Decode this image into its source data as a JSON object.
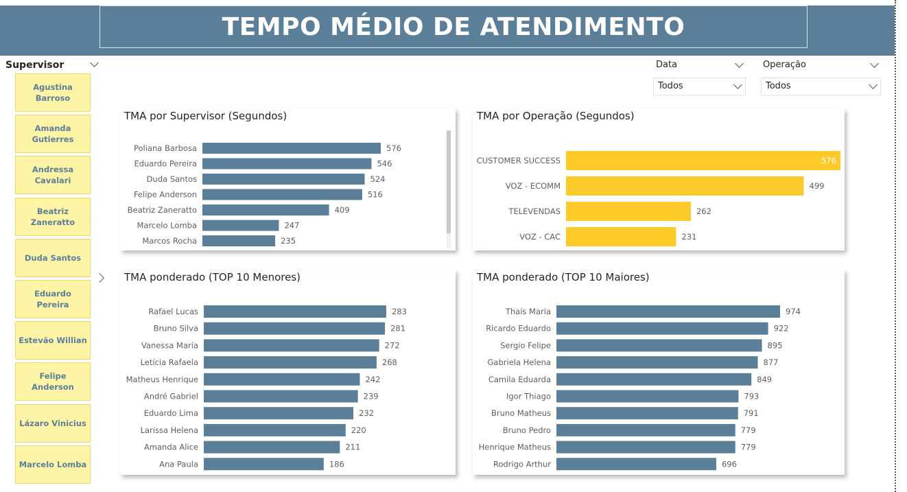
{
  "header": {
    "title": "TEMPO MÉDIO DE ATENDIMENTO"
  },
  "slicers": {
    "supervisor": {
      "label": "Supervisor",
      "items": [
        "Agustina Barroso",
        "Amanda Gutierres",
        "Andressa Cavalari",
        "Beatriz Zaneratto",
        "Duda Santos",
        "Eduardo Pereira",
        "Estevão Willian",
        "Felipe Anderson",
        "Lázaro Vinicius",
        "Marcelo Lomba"
      ]
    },
    "data": {
      "label": "Data",
      "value": "Todos"
    },
    "operacao": {
      "label": "Operação",
      "value": "Todos"
    }
  },
  "colors": {
    "bar_primary": "#5b7f99",
    "bar_accent": "#fccb29",
    "header_bg": "#5b7f99",
    "slicer_bg": "#fdf4a6",
    "slicer_text": "#5b7f99"
  },
  "chart_data": [
    {
      "id": "tma-supervisor",
      "type": "bar",
      "orientation": "horizontal",
      "title": "TMA por Supervisor (Segundos)",
      "categories": [
        "Poliana Barbosa",
        "Eduardo Pereira",
        "Duda Santos",
        "Felipe Anderson",
        "Beatriz Zaneratto",
        "Marcelo Lomba",
        "Marcos Rocha"
      ],
      "values": [
        576,
        546,
        524,
        516,
        409,
        247,
        235
      ],
      "color": "#5b7f99",
      "xlim": [
        0,
        576
      ]
    },
    {
      "id": "tma-operacao",
      "type": "bar",
      "orientation": "horizontal",
      "title": "TMA por Operação (Segundos)",
      "categories": [
        "CUSTOMER SUCCESS",
        "VOZ - ECOMM",
        "TELEVENDAS",
        "VOZ - CAC"
      ],
      "values": [
        576,
        499,
        262,
        231
      ],
      "color": "#fccb29",
      "xlim": [
        0,
        576
      ]
    },
    {
      "id": "tma-top10-menores",
      "type": "bar",
      "orientation": "horizontal",
      "title": "TMA ponderado (TOP 10 Menores)",
      "categories": [
        "Rafael Lucas",
        "Bruno Silva",
        "Vanessa Maria",
        "Letícia Rafaela",
        "Matheus Henrique",
        "André Gabriel",
        "Eduardo Lima",
        "Larissa Helena",
        "Amanda Alice",
        "Ana Paula"
      ],
      "values": [
        283,
        281,
        272,
        268,
        242,
        239,
        232,
        220,
        211,
        186
      ],
      "color": "#5b7f99",
      "xlim": [
        0,
        283
      ]
    },
    {
      "id": "tma-top10-maiores",
      "type": "bar",
      "orientation": "horizontal",
      "title": "TMA ponderado (TOP 10 Maiores)",
      "categories": [
        "Thaís Maria",
        "Ricardo Eduardo",
        "Sergio Felipe",
        "Gabriela Helena",
        "Camila Eduarda",
        "Igor Thiago",
        "Bruno Matheus",
        "Bruno Pedro",
        "Henrique Matheus",
        "Rodrigo Arthur"
      ],
      "values": [
        974,
        922,
        895,
        877,
        849,
        793,
        791,
        779,
        779,
        696
      ],
      "color": "#5b7f99",
      "xlim": [
        0,
        974
      ]
    }
  ]
}
